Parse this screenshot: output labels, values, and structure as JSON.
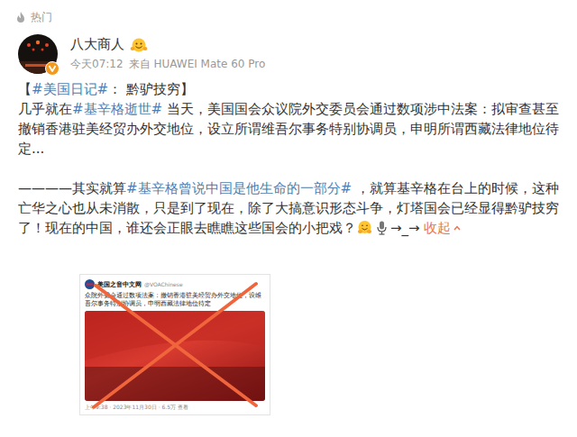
{
  "header": {
    "label": "热门"
  },
  "post": {
    "author": {
      "name": "八大商人",
      "verified": true
    },
    "meta": {
      "time": "今天07:12",
      "source": "来自 HUAWEI Mate 60 Pro"
    },
    "paragraphs": [
      {
        "segments": [
          {
            "kind": "text",
            "text": "【"
          },
          {
            "kind": "hashtag",
            "text": "#美国日记#"
          },
          {
            "kind": "text",
            "text": "： 黔驴技穷】"
          }
        ]
      },
      {
        "segments": [
          {
            "kind": "text",
            "text": "几乎就在"
          },
          {
            "kind": "hashtag",
            "text": "#基辛格逝世#"
          },
          {
            "kind": "text",
            "text": " 当天，美国国会众议院外交委员会通过数项涉中法案：拟审查甚至撤销香港驻美经贸办外交地位，设立所谓维吾尔事务特别协调员，申明所谓西藏法律地位待定..."
          }
        ]
      },
      {
        "segments": [
          {
            "kind": "text",
            "text": "————其实就算"
          },
          {
            "kind": "hashtag",
            "text": "#基辛格曾说中国是他生命的一部分#"
          },
          {
            "kind": "text",
            "text": " ，就算基辛格在台上的时候，这种亡华之心也从未消散，只是到了现在，除了大搞意识形态斗争，灯塔国会已经显得黔驴技穷了！现在的中国，谁还会正眼去瞧瞧这些国会的小把戏？"
          }
        ]
      }
    ],
    "tail": "→_→",
    "toggle": "收起"
  },
  "embed": {
    "account": "美国之音中文网",
    "handle": "@VOAChinese",
    "text": "众院外委会通过数项法案：撤销香港驻美经贸办外交地位，设维吾尔事务特别协调员，申明西藏法律地位待定",
    "meta": "上午9:38 · 2023年11月30日 · 6.5万 查看",
    "crossed": true
  }
}
